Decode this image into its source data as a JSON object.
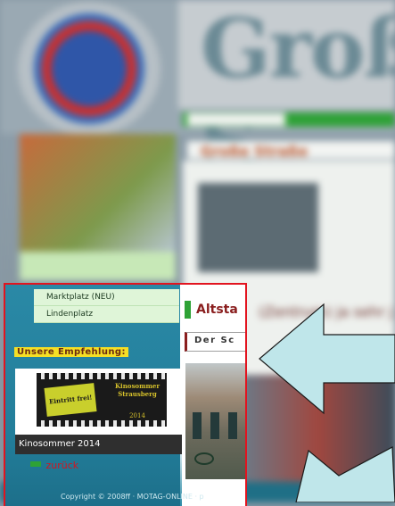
{
  "submenu": {
    "items": [
      "Marktplatz (NEU)",
      "Lindenplatz"
    ]
  },
  "recommendation": {
    "label": "Unsere Empfehlung:",
    "promo": {
      "ticket_text": "Eintritt frei!",
      "brand": "Kinosommer Strausberg",
      "year": "2014",
      "caption": "Kinosommer 2014"
    },
    "back_label": "zurück"
  },
  "content": {
    "section_title": "Altsta",
    "sub_title": "Der Sc"
  },
  "footer": {
    "copyright": "Copyright © 2008ff · MOTAG-ONLINE · p"
  },
  "colors": {
    "highlight_border": "#e2141f",
    "arrow_fill": "#bfe6ea",
    "accent_green": "#2ea236"
  }
}
